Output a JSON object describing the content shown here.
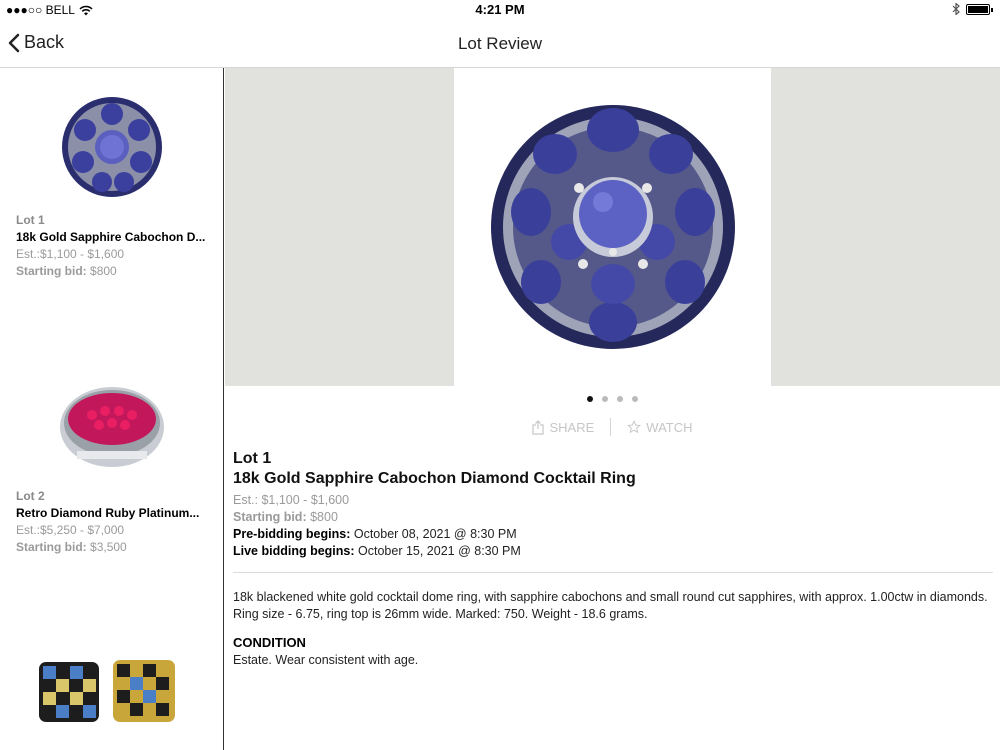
{
  "status_bar": {
    "carrier": "●●●○○ BELL",
    "time": "4:21 PM"
  },
  "nav": {
    "back_label": "Back",
    "title": "Lot Review"
  },
  "sidebar": {
    "lots": [
      {
        "lot": "Lot 1",
        "title": "18k Gold Sapphire Cabochon D...",
        "est": "Est.:$1,100 - $1,600",
        "start_label": "Starting bid:",
        "start_value": "$800",
        "thumb": "sapphire-ring-thumbnail"
      },
      {
        "lot": "Lot 2",
        "title": "Retro Diamond Ruby Platinum...",
        "est": "Est.:$5,250 - $7,000",
        "start_label": "Starting bid:",
        "start_value": "$3,500",
        "thumb": "ruby-ring-thumbnail"
      },
      {
        "thumb": "checkerboard-earrings-thumbnail"
      }
    ]
  },
  "main": {
    "carousel": {
      "image": "sapphire-cocktail-ring-photo",
      "dots": 4,
      "active_dot": 0
    },
    "actions": {
      "share": "SHARE",
      "watch": "WATCH"
    },
    "detail": {
      "lot": "Lot 1",
      "title": "18k Gold Sapphire Cabochon Diamond Cocktail Ring",
      "est": "Est.: $1,100 - $1,600",
      "start_label": "Starting bid:",
      "start_value": "$800",
      "pre_label": "Pre-bidding begins:",
      "pre_value": "October 08, 2021 @ 8:30 PM",
      "live_label": "Live bidding begins:",
      "live_value": "October 15, 2021 @ 8:30 PM",
      "description": "18k blackened white gold cocktail dome ring, with sapphire cabochons and small round cut sapphires, with approx. 1.00ctw in diamonds. Ring size - 6.75, ring top is 26mm wide. Marked: 750. Weight - 18.6 grams.",
      "condition_heading": "CONDITION",
      "condition": "Estate. Wear consistent with age."
    }
  },
  "colors": {
    "hero_bg": "#e1e1dd",
    "sapphire": "#3a3f9a",
    "ruby": "#c2185b"
  }
}
